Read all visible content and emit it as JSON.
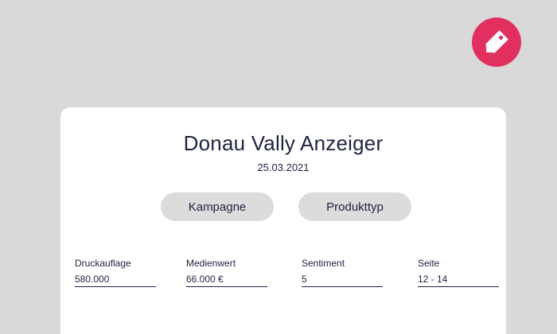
{
  "badge": {
    "icon": "price-tag-icon",
    "color": "#e1305f"
  },
  "card": {
    "title": "Donau Vally Anzeiger",
    "date": "25.03.2021",
    "buttons": {
      "kampagne": "Kampagne",
      "produkttyp": "Produkttyp"
    },
    "fields": [
      {
        "label": "Druckauflage",
        "value": "580.000"
      },
      {
        "label": "Medienwert",
        "value": "66.000 €"
      },
      {
        "label": "Sentiment",
        "value": "5"
      },
      {
        "label": "Seite",
        "value": "12 - 14"
      }
    ]
  }
}
